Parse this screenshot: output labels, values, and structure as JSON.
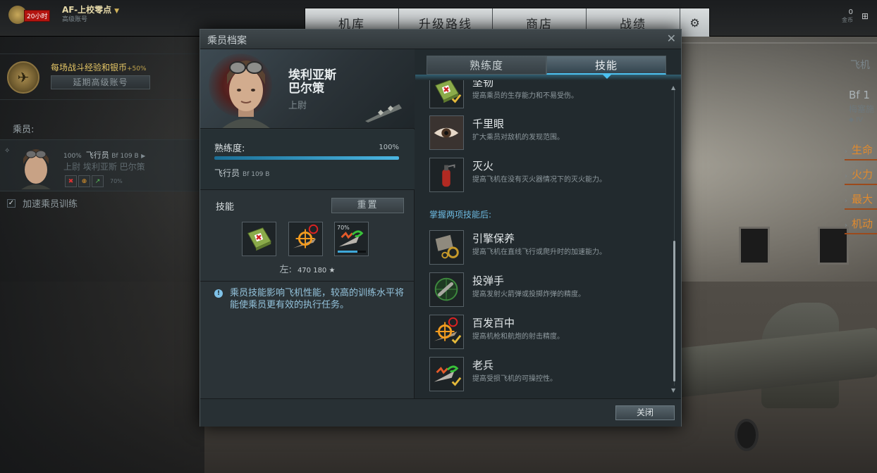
{
  "topbar": {
    "timer": "20小时",
    "rank_title": "AF-上校零点",
    "rank_sub": "高级账号",
    "tabs": [
      "机库",
      "升级路线",
      "商店",
      "战绩"
    ],
    "gold_value": "0",
    "gold_label": "金币"
  },
  "left_panel": {
    "premium_text": "每场战斗经验和银币",
    "premium_pct": "+50%",
    "premium_button": "延期高级账号",
    "crew_label": "乘员:",
    "crew_pct": "100%",
    "crew_role": "飞行员",
    "crew_model": "Bf 109 B",
    "crew_name": "上尉 埃利亚斯 巴尔策",
    "crew_skill_pct": "70%",
    "accelerate_label": "加速乘员训练",
    "accelerate_checked": "✓"
  },
  "right_panel": {
    "title": "飞机",
    "model": "Bf 1",
    "maker": "梅塞施",
    "tier": "IV",
    "items": [
      "生命",
      "火力",
      "最大",
      "机动"
    ]
  },
  "modal": {
    "title": "乘员档案",
    "pilot_name_line1": "埃利亚斯",
    "pilot_name_line2": "巴尔策",
    "pilot_rank": "上尉",
    "proficiency_label": "熟练度:",
    "proficiency_pct": "100%",
    "proficiency_value": 1.0,
    "role": "飞行员",
    "role_model": "Bf 109 B",
    "skills_label": "技能",
    "reset_button": "重置",
    "slot3_pct": "70%",
    "slot3_progress": 0.7,
    "left_label": "左:",
    "left_value": "470 180 ★",
    "info_text": "乘员技能影响飞机性能，较高的训练水平将能使乘员更有效的执行任务。",
    "tabs": [
      "熟练度",
      "技能"
    ],
    "skills": [
      {
        "name": "坚韧",
        "desc": "提高乘员的生存能力和不易受伤。",
        "icon": "first-aid-kit-icon",
        "learned": true
      },
      {
        "name": "千里眼",
        "desc": "扩大乘员对敌机的发现范围。",
        "icon": "eye-icon",
        "learned": false
      },
      {
        "name": "灭火",
        "desc": "提高飞机在没有灭火器情况下的灭火能力。",
        "icon": "fire-extinguisher-icon",
        "learned": false
      }
    ],
    "section_after_two": "掌握两项技能后:",
    "skills_advanced": [
      {
        "name": "引擎保养",
        "desc": "提高飞机在直线飞行或爬升时的加速能力。",
        "icon": "engine-gears-icon",
        "learned": false
      },
      {
        "name": "投弹手",
        "desc": "提高发射火箭弹或投掷炸弹的精度。",
        "icon": "bomb-icon",
        "learned": false
      },
      {
        "name": "百发百中",
        "desc": "提高机枪和航炮的射击精度。",
        "icon": "crosshair-icon",
        "learned": true
      },
      {
        "name": "老兵",
        "desc": "提高受损飞机的可操控性。",
        "icon": "damaged-plane-icon",
        "learned": true
      }
    ],
    "close_button": "关闭"
  },
  "colors": {
    "accent_blue": "#4cc1f0",
    "info_text": "#94c3dc",
    "gold": "#e6c766",
    "orange": "#e08a2e",
    "check_gold": "#e3b83a"
  }
}
